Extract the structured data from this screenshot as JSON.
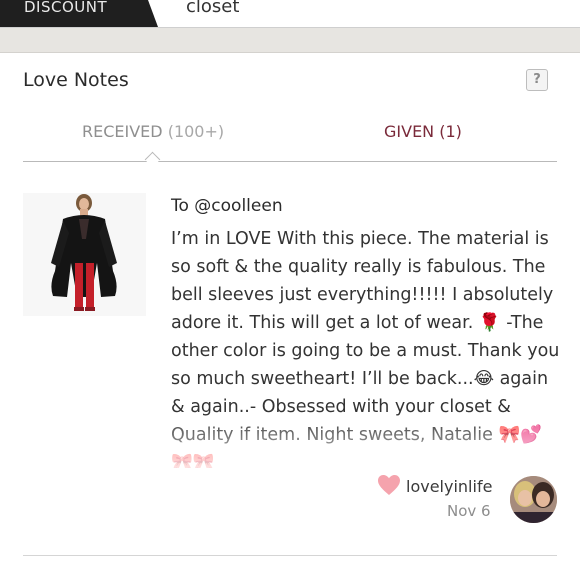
{
  "topbar": {
    "discount_label": "DISCOUNT",
    "closet_label": "closet"
  },
  "header": {
    "title": "Love Notes",
    "help_label": "?"
  },
  "tabs": {
    "received_label": "RECEIVED",
    "received_count": "(100+)",
    "given_label": "GIVEN (1)"
  },
  "note": {
    "recipient": "To @coolleen",
    "text": "I’m in LOVE With this piece. The material is so soft & the quality really is fabulous. The bell sleeves just everything!!!!! I absolutely adore it. This will get a lot of wear. 🌹 -The other color is going to be a must. Thank you so much sweetheart! I’ll be back...😂 again & again..- Obsessed with your closet & Quality if item. Night sweets, Natalie 🎀💕🎀🎀",
    "username": "lovelyinlife",
    "date": "Nov 6"
  },
  "colors": {
    "given_tab": "#7a2a3a",
    "heart": "#f5a3ad",
    "discount_bg": "#1f1f1f"
  },
  "icons": {
    "help": "question-icon",
    "heart": "heart-icon"
  }
}
